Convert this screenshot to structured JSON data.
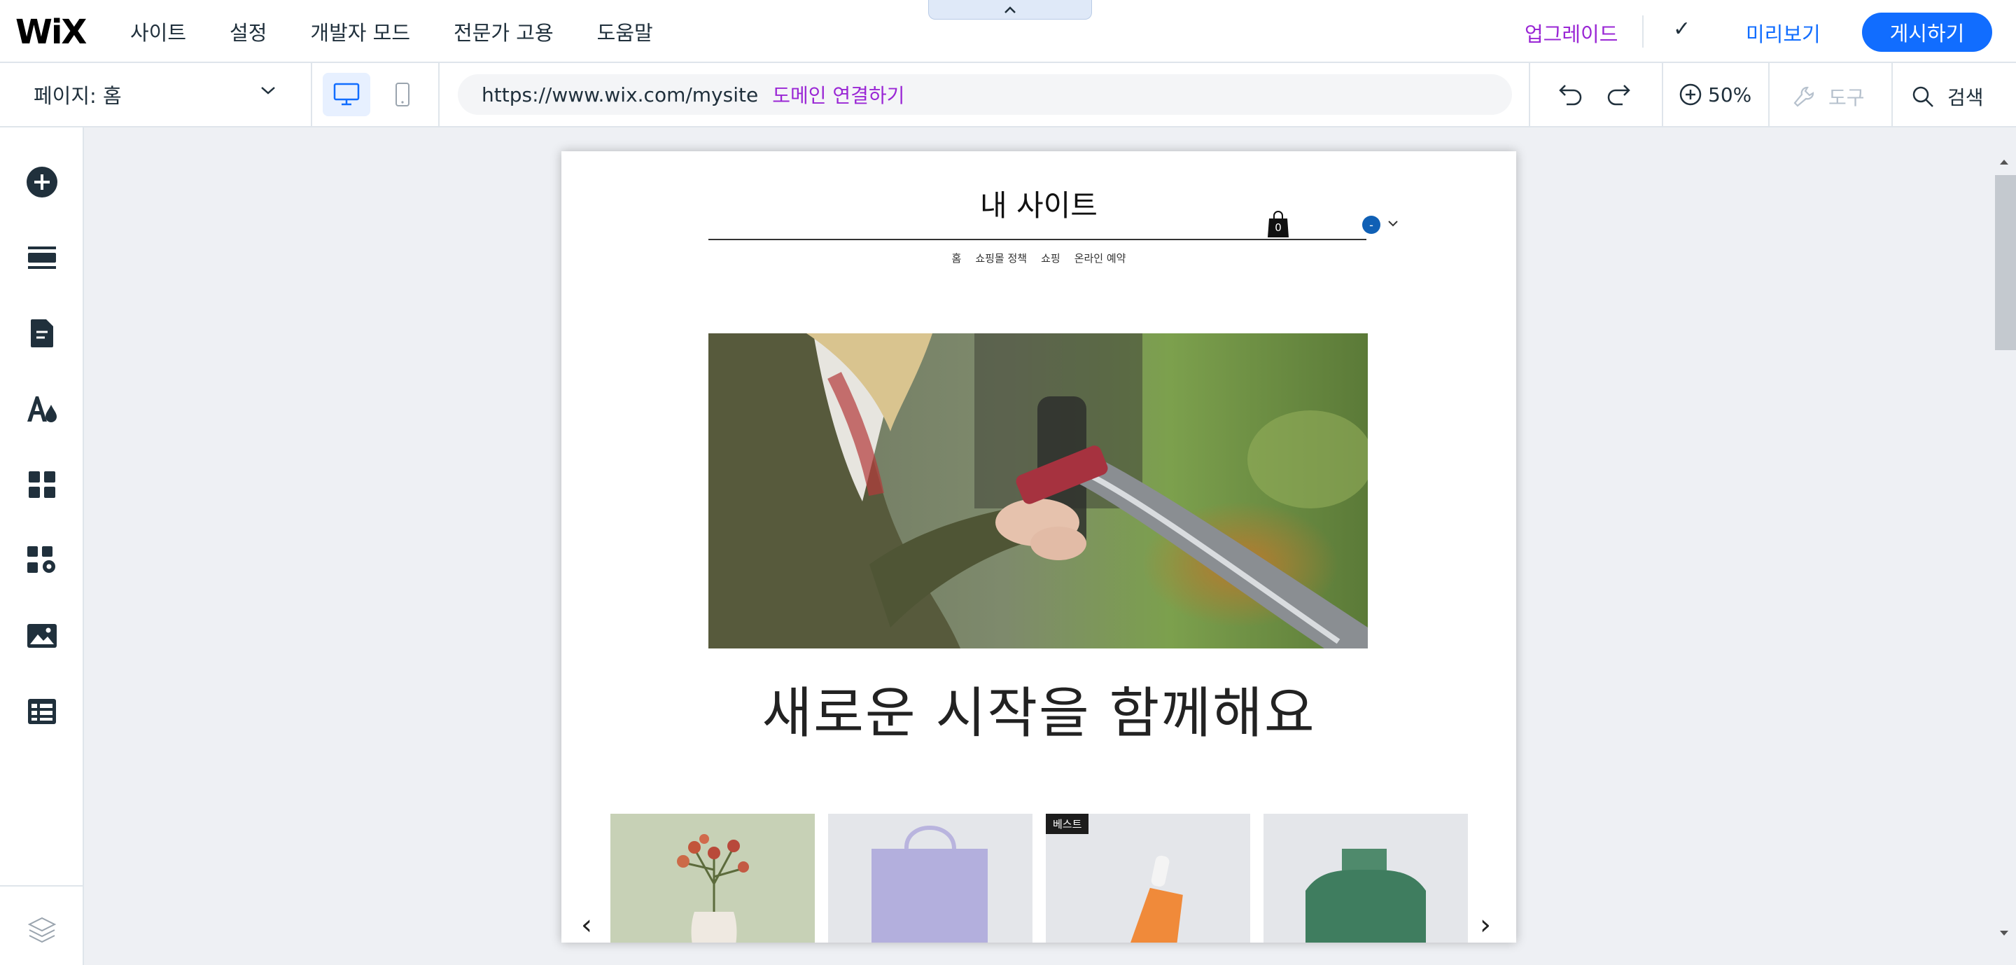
{
  "app": {
    "logo": "WiX",
    "menu": [
      "사이트",
      "설정",
      "개발자 모드",
      "전문가 고용",
      "도움말"
    ],
    "upgrade_label": "업그레이드",
    "preview_label": "미리보기",
    "publish_label": "게시하기"
  },
  "subbar": {
    "page_selector": "페이지: 홈",
    "url": "https://www.wix.com/mysite",
    "connect_domain": "도메인 연결하기",
    "zoom": "50%",
    "tools_label": "도구",
    "search_label": "검색"
  },
  "sidebar": {
    "icons": [
      "add-icon",
      "sections-icon",
      "pages-icon",
      "design-icon",
      "apps-icon",
      "business-apps-icon",
      "media-icon",
      "cms-icon",
      "layers-icon"
    ]
  },
  "site": {
    "title": "내 사이트",
    "cart_count": "0",
    "login_initial": "-",
    "nav": [
      "홈",
      "쇼핑몰 정책",
      "쇼핑",
      "온라인 예약"
    ],
    "headline": "새로운 시작을 함께해요",
    "badge": "베스트"
  },
  "colors": {
    "accent_blue": "#116dff",
    "upgrade_purple": "#9a27d5",
    "canvas_bg": "#eef0f4"
  }
}
